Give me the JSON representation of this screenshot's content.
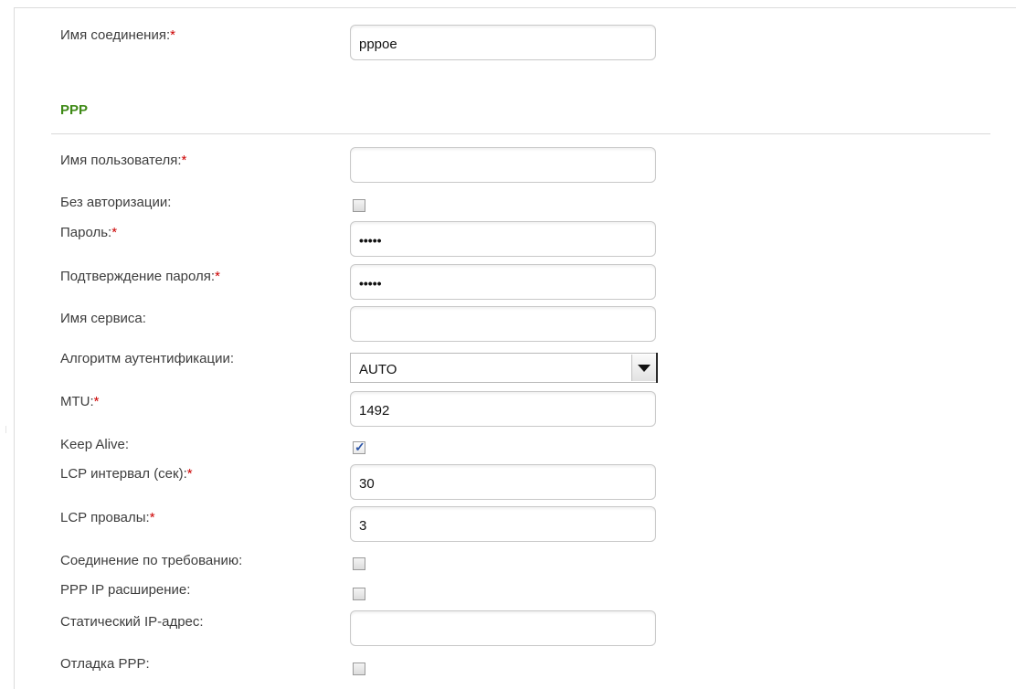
{
  "connection": {
    "name_label": "Имя соединения:",
    "name_value": "pppoe"
  },
  "section": {
    "title": "PPP"
  },
  "ppp": {
    "username_label": "Имя пользователя:",
    "username_value": "",
    "no_auth_label": "Без авторизации:",
    "no_auth_checked": false,
    "password_label": "Пароль:",
    "password_value": "•••••",
    "password_confirm_label": "Подтверждение пароля:",
    "password_confirm_value": "•••••",
    "service_label": "Имя сервиса:",
    "service_value": "",
    "auth_algo_label": "Алгоритм аутентификации:",
    "auth_algo_value": "AUTO",
    "mtu_label": "MTU:",
    "mtu_value": "1492",
    "keepalive_label": "Keep Alive:",
    "keepalive_checked": true,
    "lcp_interval_label": "LCP интервал (сек):",
    "lcp_interval_value": "30",
    "lcp_fails_label": "LCP провалы:",
    "lcp_fails_value": "3",
    "on_demand_label": "Соединение по требованию:",
    "on_demand_checked": false,
    "ip_ext_label": "PPP IP расширение:",
    "ip_ext_checked": false,
    "static_ip_label": "Статический IP-адрес:",
    "static_ip_value": "",
    "debug_label": "Отладка PPP:",
    "debug_checked": false
  },
  "required_mark": "*",
  "check_mark": "✓",
  "colors": {
    "section_title": "#3f8a17",
    "required": "#cc0000",
    "check": "#2d56a8"
  }
}
